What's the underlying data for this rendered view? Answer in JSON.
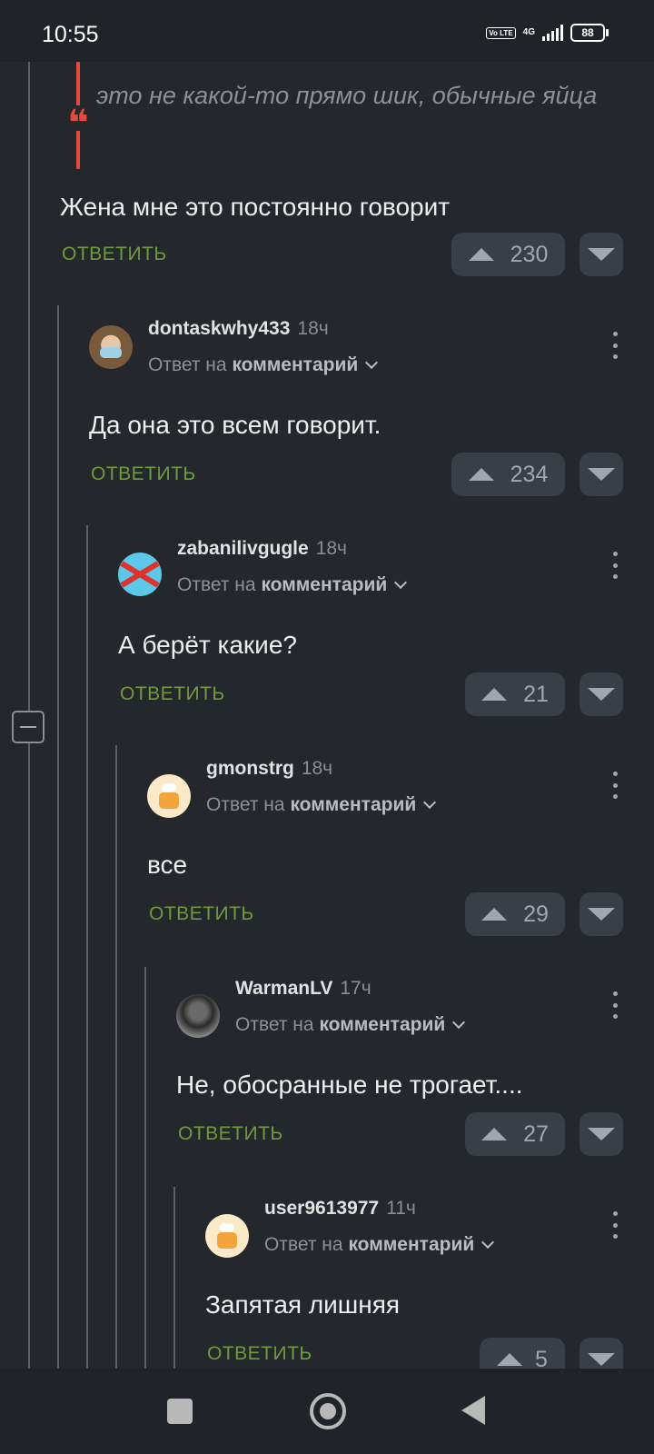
{
  "status_bar": {
    "time": "10:55",
    "volte": "Vo LTE",
    "network": "4G",
    "battery": "88"
  },
  "quote": {
    "text": "это не какой-то прямо шик, обычные яйца",
    "mark": "❝"
  },
  "top_comment": {
    "text": "Жена мне это постоянно говорит",
    "reply_label": "ОТВЕТИТЬ",
    "votes": "230"
  },
  "comments": [
    {
      "username": "dontaskwhy433",
      "time": "18ч",
      "reply_prefix": "Ответ на",
      "reply_target": "комментарий",
      "text": "Да она это всем говорит.",
      "reply_label": "ОТВЕТИТЬ",
      "votes": "234"
    },
    {
      "username": "zabanilivgugle",
      "time": "18ч",
      "reply_prefix": "Ответ на",
      "reply_target": "комментарий",
      "text": "А берёт какие?",
      "reply_label": "ОТВЕТИТЬ",
      "votes": "21"
    },
    {
      "username": "gmonstrg",
      "time": "18ч",
      "reply_prefix": "Ответ на",
      "reply_target": "комментарий",
      "text": "все",
      "reply_label": "ОТВЕТИТЬ",
      "votes": "29"
    },
    {
      "username": "WarmanLV",
      "time": "17ч",
      "reply_prefix": "Ответ на",
      "reply_target": "комментарий",
      "text": "Не, обосранные не трогает....",
      "reply_label": "ОТВЕТИТЬ",
      "votes": "27"
    },
    {
      "username": "user9613977",
      "time": "11ч",
      "reply_prefix": "Ответ на",
      "reply_target": "комментарий",
      "text": "Запятая лишняя",
      "reply_label": "ОТВЕТИТЬ",
      "votes": "5"
    }
  ],
  "colors": {
    "background": "#24272c",
    "reply_green": "#6f9a3e",
    "quote_red": "#e24a3b"
  }
}
